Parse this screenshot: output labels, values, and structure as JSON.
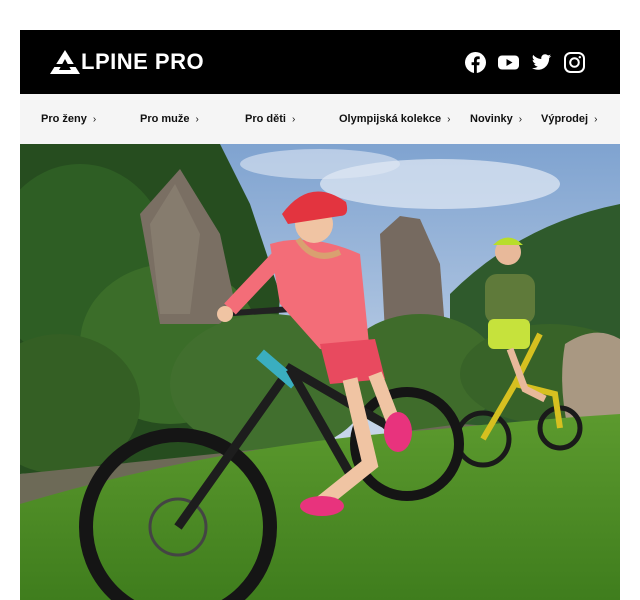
{
  "brand": {
    "name": "LPINE PRO"
  },
  "social": [
    {
      "icon": "facebook-icon"
    },
    {
      "icon": "youtube-icon"
    },
    {
      "icon": "twitter-icon"
    },
    {
      "icon": "instagram-icon"
    }
  ],
  "nav": {
    "items": [
      {
        "label": "Pro ženy",
        "chevron": "›"
      },
      {
        "label": "Pro muže",
        "chevron": "›"
      },
      {
        "label": "Pro děti",
        "chevron": "›"
      },
      {
        "label": "Olympijská kolekce",
        "chevron": "›"
      },
      {
        "label": "Novinky",
        "chevron": "›"
      },
      {
        "label": "Výprodej",
        "chevron": "›"
      }
    ]
  },
  "colors": {
    "header_bg": "#000000",
    "nav_bg": "#f5f5f5",
    "accent_pink": "#f2607a",
    "accent_lime": "#c6e23c"
  }
}
